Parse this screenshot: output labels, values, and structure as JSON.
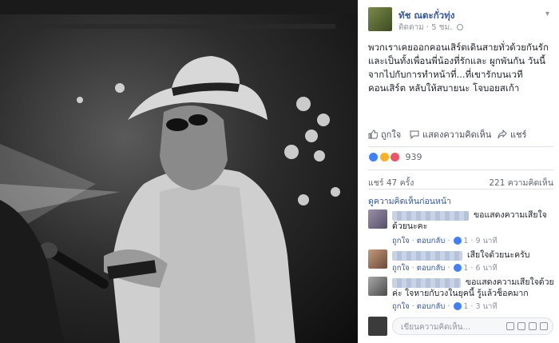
{
  "post": {
    "author": "ทัช ณตะกั่วทุ่ง",
    "follow_label": "ติดตาม",
    "separator": "·",
    "time": "5 ชม.",
    "text": "พวกเราเคยออกคอนเสิร์ตเดินสายทั่วด้วยกันรักและเป็นทั้งเพื่อนพี่น้องที่รักและ ผูกพันกัน วันนี้จากไปกับการทำหน้าที่...ที่เขารักบนเวทีคอนเสิร์ต หลับให้สบายนะ โจบอยสเก้า"
  },
  "actions": {
    "like": "ถูกใจ",
    "comment": "แสดงความคิดเห็น",
    "share": "แชร์"
  },
  "reactions": {
    "count": "939"
  },
  "stats": {
    "shares": "แชร์ 47 ครั้ง",
    "comments": "221 ความคิดเห็น"
  },
  "comments_section": {
    "view_previous": "ดูความคิดเห็นก่อนหน้า",
    "items": [
      {
        "text": "ขอแสดงความเสียใจด้วยนะคะ",
        "like": "ถูกใจ",
        "reply": "ตอบกลับ",
        "likes": "1",
        "time": "9 นาที"
      },
      {
        "text": "เสียใจด้วยนะครับ",
        "like": "ถูกใจ",
        "reply": "ตอบกลับ",
        "likes": "1",
        "time": "6 นาที"
      },
      {
        "text": "ขอแสดงความเสียใจด้วยค่ะ ใจหายกับวงในยุคนี้ รู้แล้วช็อคมาก",
        "like": "ถูกใจ",
        "reply": "ตอบกลับ",
        "likes": "1",
        "time": "3 นาที"
      }
    ]
  },
  "composer": {
    "placeholder": "เขียนความคิดเห็น..."
  },
  "colors": {
    "link": "#365899",
    "like_reaction": "#4080ff",
    "love_reaction": "#f25268",
    "sad_reaction": "#f7b125"
  }
}
